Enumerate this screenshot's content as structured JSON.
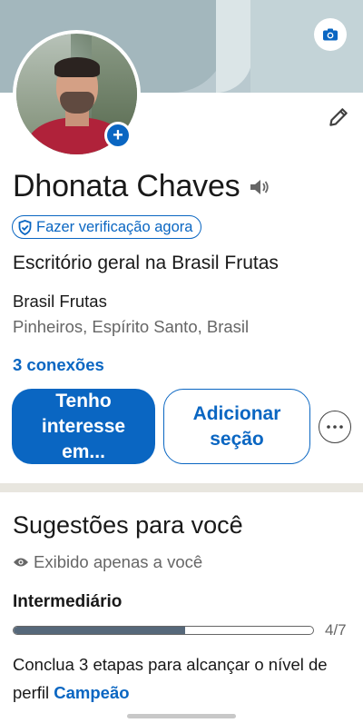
{
  "profile": {
    "name": "Dhonata Chaves",
    "verify_label": "Fazer verificação agora",
    "headline": "Escritório geral na Brasil Frutas",
    "company": "Brasil Frutas",
    "location": "Pinheiros, Espírito Santo, Brasil",
    "connections": "3 conexões"
  },
  "actions": {
    "primary_label": "Tenho interesse em...",
    "secondary_label": "Adicionar seção",
    "more_icon": "ellipsis-icon"
  },
  "icons": {
    "camera": "camera-icon",
    "add_photo": "plus-icon",
    "edit": "pencil-icon",
    "speaker": "speaker-icon",
    "shield": "shield-check-icon",
    "eye": "eye-icon"
  },
  "suggestions": {
    "title": "Sugestões para você",
    "visibility": "Exibido apenas a você",
    "level": "Intermediário",
    "progress_label": "4/7",
    "progress_fraction": 0.5714,
    "description_prefix": "Conclua 3 etapas para alcançar o nível de perfil",
    "description_link": "Campeão"
  },
  "colors": {
    "accent": "#0a66c2",
    "progress_fill": "#56687a",
    "divider": "#e8e6df"
  }
}
